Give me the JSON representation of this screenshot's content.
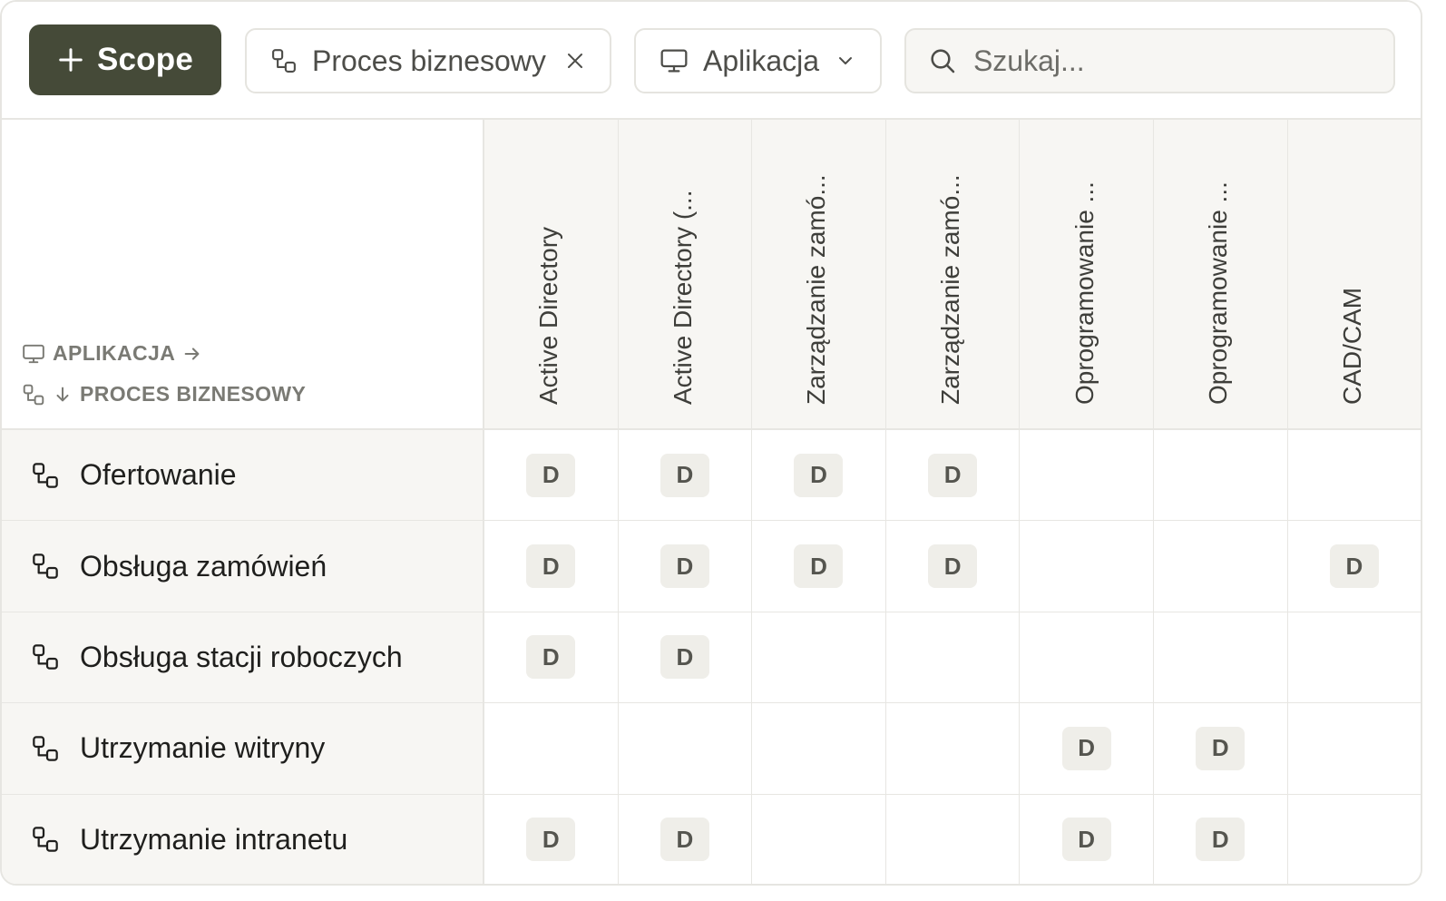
{
  "toolbar": {
    "scope_button_label": "Scope",
    "process_chip_label": "Proces biznesowy",
    "application_chip_label": "Aplikacja",
    "search_placeholder": "Szukaj..."
  },
  "matrix": {
    "axis_columns_label": "APLIKACJA",
    "axis_rows_label": "PROCES BIZNESOWY",
    "columns": [
      "Active Directory",
      "Active Directory (...",
      "Zarządzanie zamó...",
      "Zarządzanie zamó...",
      "Oprogramowanie ...",
      "Oprogramowanie ...",
      "CAD/CAM"
    ],
    "rows": [
      {
        "label": "Ofertowanie",
        "cells": [
          "D",
          "D",
          "D",
          "D",
          "",
          "",
          ""
        ]
      },
      {
        "label": "Obsługa zamówień",
        "cells": [
          "D",
          "D",
          "D",
          "D",
          "",
          "",
          "D"
        ]
      },
      {
        "label": "Obsługa stacji roboczych",
        "cells": [
          "D",
          "D",
          "",
          "",
          "",
          "",
          ""
        ]
      },
      {
        "label": "Utrzymanie witryny",
        "cells": [
          "",
          "",
          "",
          "",
          "D",
          "D",
          ""
        ]
      },
      {
        "label": "Utrzymanie intranetu",
        "cells": [
          "D",
          "D",
          "",
          "",
          "D",
          "D",
          ""
        ]
      }
    ]
  },
  "icons": {
    "scope": "plus-icon",
    "process": "process-flow-icon",
    "application": "monitor-icon",
    "dropdown": "chevron-down-icon",
    "remove": "close-icon",
    "search": "search-icon",
    "arrow_right": "arrow-right-icon",
    "arrow_down": "arrow-down-icon"
  },
  "colors": {
    "primary_button": "#454a38",
    "header_bg": "#f7f6f3",
    "badge_bg": "#efeee9",
    "border": "#e7e6e2"
  }
}
